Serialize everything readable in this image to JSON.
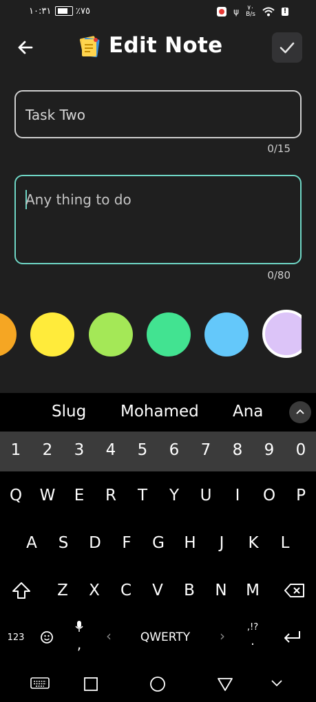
{
  "status_bar": {
    "time": "١٠:٣١",
    "battery_pct": "٪٧٥",
    "net_speed_top": "٧٠",
    "net_speed_unit": "B/s"
  },
  "header": {
    "title": "Edit Note"
  },
  "title_field": {
    "value": "Task Two",
    "counter": "0/15"
  },
  "desc_field": {
    "placeholder": "Any thing to do",
    "counter": "0/80"
  },
  "colors": {
    "swatches": [
      "#f5a623",
      "#ffeb3b",
      "#a4e857",
      "#42e391",
      "#64c8fa",
      "#dcc4f8"
    ],
    "selected_index": 5,
    "accent": "#6fd6c5"
  },
  "keyboard": {
    "suggestions": [
      "Slug",
      "Mohamed",
      "Ana"
    ],
    "numbers": [
      "1",
      "2",
      "3",
      "4",
      "5",
      "6",
      "7",
      "8",
      "9",
      "0"
    ],
    "row1": [
      "Q",
      "W",
      "E",
      "R",
      "T",
      "Y",
      "U",
      "I",
      "O",
      "P"
    ],
    "row2": [
      "A",
      "S",
      "D",
      "F",
      "G",
      "H",
      "J",
      "K",
      "L"
    ],
    "row3": [
      "Z",
      "X",
      "C",
      "V",
      "B",
      "N",
      "M"
    ],
    "symbols_label": "123",
    "space_label": "QWERTY",
    "comma": ",",
    "punct_top": ",!?",
    "punct_bottom": "."
  }
}
